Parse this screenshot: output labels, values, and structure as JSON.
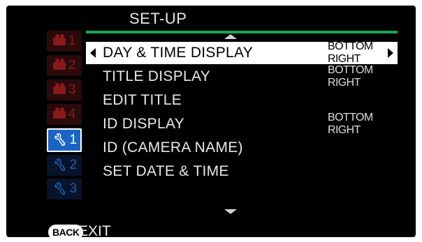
{
  "header": {
    "title": "SET-UP"
  },
  "sidebar": {
    "tabs": [
      {
        "num": "1",
        "kind": "camera",
        "active": false
      },
      {
        "num": "2",
        "kind": "camera",
        "active": false
      },
      {
        "num": "3",
        "kind": "camera",
        "active": false
      },
      {
        "num": "4",
        "kind": "camera",
        "active": false
      },
      {
        "num": "1",
        "kind": "wrench",
        "active": true
      },
      {
        "num": "2",
        "kind": "wrench",
        "active": false
      },
      {
        "num": "3",
        "kind": "wrench",
        "active": false
      }
    ]
  },
  "menu": {
    "items": [
      {
        "label": "DAY & TIME DISPLAY",
        "value": "BOTTOM RIGHT",
        "selected": true
      },
      {
        "label": "TITLE DISPLAY",
        "value": "BOTTOM RIGHT",
        "selected": false
      },
      {
        "label": "EDIT TITLE",
        "value": "",
        "selected": false
      },
      {
        "label": "ID DISPLAY",
        "value": "BOTTOM RIGHT",
        "selected": false
      },
      {
        "label": "ID (CAMERA NAME)",
        "value": "",
        "selected": false
      },
      {
        "label": "SET DATE & TIME",
        "value": "",
        "selected": false
      }
    ]
  },
  "footer": {
    "back_label": "BACK",
    "exit_label": "EXIT"
  },
  "colors": {
    "accent_green": "#1aa64b",
    "active_tab": "#1a64c8",
    "camera_tab": "#8a1a1a"
  }
}
